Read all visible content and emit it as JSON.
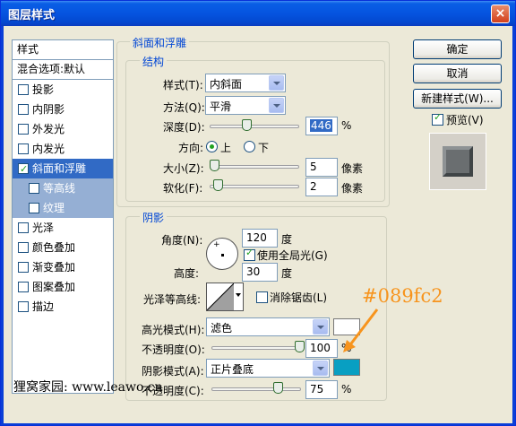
{
  "window": {
    "title": "图层样式",
    "close_label": "×"
  },
  "left_list": {
    "header": "样式",
    "blend_options": "混合选项:默认",
    "items": [
      {
        "label": "投影",
        "checked": false
      },
      {
        "label": "内阴影",
        "checked": false
      },
      {
        "label": "外发光",
        "checked": false
      },
      {
        "label": "内发光",
        "checked": false
      },
      {
        "label": "斜面和浮雕",
        "checked": true
      },
      {
        "label": "等高线",
        "checked": false
      },
      {
        "label": "纹理",
        "checked": false
      },
      {
        "label": "光泽",
        "checked": false
      },
      {
        "label": "颜色叠加",
        "checked": false
      },
      {
        "label": "渐变叠加",
        "checked": false
      },
      {
        "label": "图案叠加",
        "checked": false
      },
      {
        "label": "描边",
        "checked": false
      }
    ]
  },
  "bevel": {
    "group_title": "斜面和浮雕",
    "structure_title": "结构",
    "style_label": "样式(T):",
    "style_value": "内斜面",
    "technique_label": "方法(Q):",
    "technique_value": "平滑",
    "depth_label": "深度(D):",
    "depth_value": "446",
    "depth_unit": "%",
    "depth_level": 0.36,
    "direction_label": "方向:",
    "direction_up": "上",
    "direction_down": "下",
    "size_label": "大小(Z):",
    "size_value": "5",
    "size_unit": "像素",
    "soften_label": "软化(F):",
    "soften_value": "2",
    "soften_unit": "像素"
  },
  "shading": {
    "title": "阴影",
    "angle_label": "角度(N):",
    "angle_value": "120",
    "angle_unit": "度",
    "global_light_label": "使用全局光(G)",
    "altitude_label": "高度:",
    "altitude_value": "30",
    "altitude_unit": "度",
    "gloss_contour_label": "光泽等高线:",
    "anti_aliased_label": "消除锯齿(L)",
    "highlight_mode_label": "高光模式(H):",
    "highlight_mode_value": "滤色",
    "highlight_opacity_label": "不透明度(O):",
    "highlight_opacity_value": "100",
    "highlight_color": "#ffffff",
    "shadow_mode_label": "阴影模式(A):",
    "shadow_mode_value": "正片叠底",
    "shadow_opacity_label": "不透明度(C):",
    "shadow_opacity_value": "75",
    "shadow_color": "#089fc2",
    "percent": "%"
  },
  "buttons": {
    "ok": "确定",
    "cancel": "取消",
    "new_style": "新建样式(W)...",
    "preview_label": "预览(V)"
  },
  "annotation": "#089fc2",
  "watermark": "狸窝家园: www.leawo.cn"
}
